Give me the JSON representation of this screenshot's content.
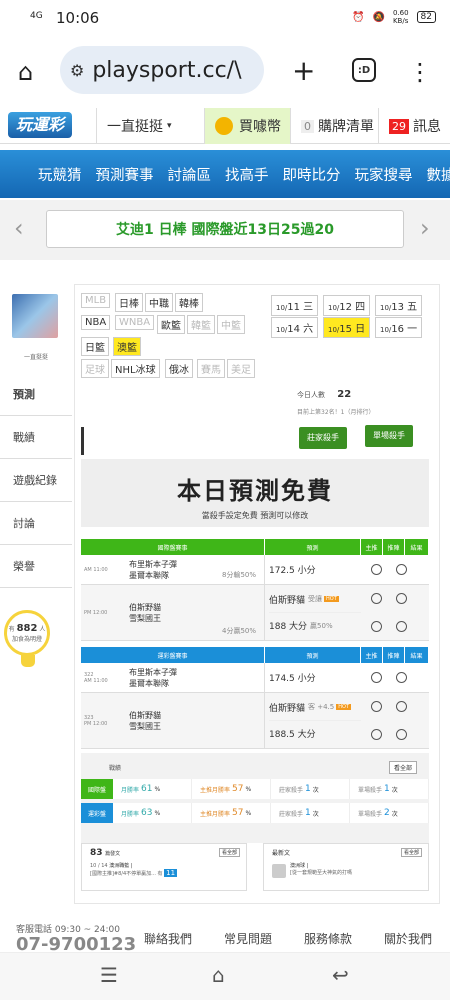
{
  "status": {
    "time": "10:06",
    "signal": "4G",
    "speed": "0.60\nKB/s",
    "battery": "82"
  },
  "browser": {
    "url": "playsport.cc/\\",
    "tab_count": ":D"
  },
  "header": {
    "logo": "玩運彩",
    "menu_label": "一直挺挺",
    "coin_label": "買噱幣",
    "cart_count": "0",
    "cart_label": "購牌清單",
    "msg_count": "29",
    "msg_label": "訊息"
  },
  "nav": [
    "玩競猜",
    "預測賽事",
    "討論區",
    "找高手",
    "即時比分",
    "玩家搜尋",
    "數據"
  ],
  "ticker": {
    "text": "艾迪1 日棒 國際盤近13日25過20"
  },
  "user": {
    "name": "一直挺挺"
  },
  "side_menu": [
    "預測",
    "戰績",
    "遊戲紀錄",
    "討論",
    "榮譽"
  ],
  "bulb": {
    "prefix": "有",
    "count": "882",
    "suffix": "人",
    "line2": "加食為明燈"
  },
  "sports": [
    {
      "label": "MLB",
      "state": "dis"
    },
    {
      "label": "日棒",
      "state": ""
    },
    {
      "label": "中職",
      "state": ""
    },
    {
      "label": "韓棒",
      "state": ""
    },
    {
      "label": "NBA",
      "state": ""
    },
    {
      "label": "WNBA",
      "state": "dis"
    },
    {
      "label": "歐籃",
      "state": ""
    },
    {
      "label": "韓籃",
      "state": "dis"
    },
    {
      "label": "中籃",
      "state": "dis"
    },
    {
      "label": "日籃",
      "state": ""
    },
    {
      "label": "澳籃",
      "state": "sel"
    },
    {
      "label": "足球",
      "state": "dis"
    },
    {
      "label": "NHL冰球",
      "state": ""
    },
    {
      "label": "俄冰",
      "state": ""
    },
    {
      "label": "賽馬",
      "state": "dis"
    },
    {
      "label": "美足",
      "state": "dis"
    }
  ],
  "dates": [
    {
      "m": "10/",
      "d": "11 三",
      "sel": false
    },
    {
      "m": "10/",
      "d": "12 四",
      "sel": false
    },
    {
      "m": "10/",
      "d": "13 五",
      "sel": false
    },
    {
      "m": "10/",
      "d": "14 六",
      "sel": false
    },
    {
      "m": "10/",
      "d": "15 日",
      "sel": true
    },
    {
      "m": "10/",
      "d": "16 一",
      "sel": false
    }
  ],
  "today": {
    "label": "今日人數",
    "count": "22",
    "rank": "目前上第32名！1（月排行）"
  },
  "promo": {
    "badge1": "莊家殺手",
    "badge2": "單場殺手",
    "big": "本日預測免費",
    "small": "當殺手設定免費 預測可以修改"
  },
  "table1": {
    "headers": [
      "國際盤賽事",
      "預測",
      "主推",
      "推陣",
      "結果"
    ],
    "color": "#3fb618",
    "rows": [
      {
        "time": "AM 11:00",
        "home": "布里斯本子彈",
        "away": "墨爾本聯隊",
        "odds": "8分輸50%",
        "picks": [
          {
            "v": "172.5 小分",
            "note": ""
          }
        ]
      },
      {
        "time": "PM 12:00",
        "home": "伯斯野貓",
        "away": "雪梨國王",
        "odds": "4分贏50%",
        "picks": [
          {
            "v": "伯斯野貓",
            "note": "受讓"
          },
          {
            "v": "188 大分",
            "note": "贏50%"
          }
        ]
      }
    ]
  },
  "table2": {
    "headers": [
      "運彩盤賽事",
      "預測",
      "主推",
      "推陣",
      "結果"
    ],
    "color": "#1b8fd8",
    "rows": [
      {
        "time": "322\nAM 11:00",
        "home": "布里斯本子彈",
        "away": "墨爾本聯隊",
        "odds": "",
        "picks": [
          {
            "v": "174.5 小分",
            "note": ""
          }
        ]
      },
      {
        "time": "323\nPM 12:00",
        "home": "伯斯野貓",
        "away": "雪梨國王",
        "odds": "",
        "picks": [
          {
            "v": "伯斯野貓",
            "note": "客 +4.5"
          },
          {
            "v": "188.5 大分",
            "note": ""
          }
        ]
      }
    ]
  },
  "record": {
    "title": "戰績",
    "more": "看全部",
    "rows": [
      {
        "label": "國際盤",
        "color": "#3fb618",
        "cells": [
          {
            "t": "月勝率",
            "v": "61",
            "u": "%"
          },
          {
            "t": "主推月勝率",
            "v": "57",
            "u": "%"
          },
          {
            "t": "莊家殺手",
            "v": "1",
            "u": "次"
          },
          {
            "t": "單場殺手",
            "v": "1",
            "u": "次"
          }
        ]
      },
      {
        "label": "運彩盤",
        "color": "#1b8fd8",
        "cells": [
          {
            "t": "月勝率",
            "v": "63",
            "u": "%"
          },
          {
            "t": "主推月勝率",
            "v": "57",
            "u": "%"
          },
          {
            "t": "莊家殺手",
            "v": "1",
            "u": "次"
          },
          {
            "t": "單場殺手",
            "v": "2",
            "u": "次"
          }
        ]
      }
    ]
  },
  "mini1": {
    "count": "83",
    "label": "篇發文",
    "more": "看全部",
    "date": "10 / 14",
    "title": "澳洲職籃 |",
    "desc": "[國際主推]#8/4不停單贏加...",
    "reply_prefix": "有",
    "reply": "11"
  },
  "mini2": {
    "label": "最新文",
    "more": "看全部",
    "title": "澳洲球 |",
    "desc": "[從一套規範至大神氣的打嗎"
  },
  "footer": {
    "tel_label": "客服電話 09:30 ~ 24:00",
    "tel": "07-9700123",
    "links": [
      "聯絡我們",
      "常見問題",
      "服務條款",
      "關於我們"
    ]
  }
}
